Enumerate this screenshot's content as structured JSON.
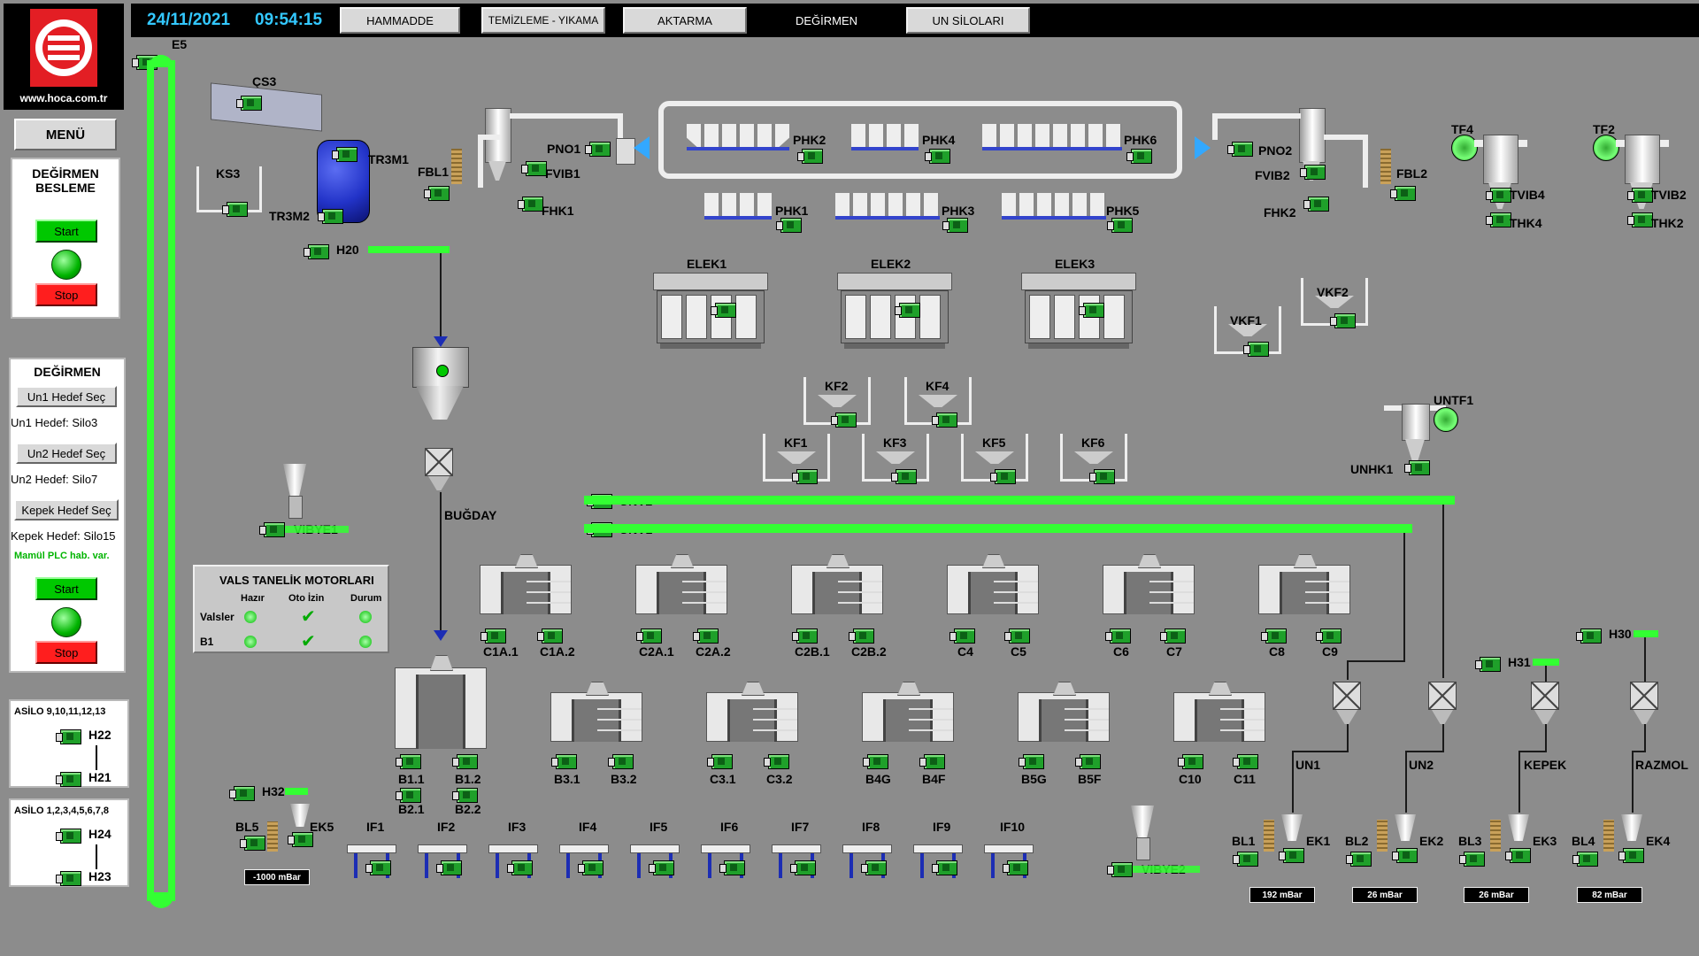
{
  "header": {
    "date": "24/11/2021",
    "time": "09:54:15",
    "logo_url": "www.hoca.com.tr",
    "tabs": [
      {
        "label": "HAMMADDE"
      },
      {
        "label": "TEMİZLEME - YIKAMA"
      },
      {
        "label": "AKTARMA"
      },
      {
        "label": "DEĞİRMEN"
      },
      {
        "label": "UN SİLOLARI"
      }
    ]
  },
  "menu_label": "MENÜ",
  "feed_panel": {
    "title_line1": "DEĞİRMEN",
    "title_line2": "BESLEME",
    "start": "Start",
    "stop": "Stop"
  },
  "mill_panel": {
    "title": "DEĞİRMEN",
    "un1_btn": "Un1 Hedef Seç",
    "un1_target": "Un1 Hedef: Silo3",
    "un2_btn": "Un2 Hedef Seç",
    "un2_target": "Un2 Hedef: Silo7",
    "kepek_btn": "Kepek Hedef Seç",
    "kepek_target": "Kepek Hedef: Silo15",
    "plc_note": "Mamül PLC hab. var.",
    "start": "Start",
    "stop": "Stop"
  },
  "asilo_a": {
    "title": "ASİLO 9,10,11,12,13",
    "m1": "H22",
    "m2": "H21"
  },
  "asilo_b": {
    "title": "ASİLO 1,2,3,4,5,6,7,8",
    "m1": "H24",
    "m2": "H23"
  },
  "vals_panel": {
    "title": "VALS TANELİK MOTORLARI",
    "col_ready": "Hazır",
    "col_auto": "Oto İzin",
    "col_state": "Durum",
    "rows": [
      {
        "name": "Valsler"
      },
      {
        "name": "B1"
      }
    ]
  },
  "labels": {
    "e5": "E5",
    "cs3": "ÇS3",
    "ks3": "KS3",
    "tr3m1": "TR3M1",
    "tr3m2": "TR3M2",
    "h20": "H20",
    "fbl1": "FBL1",
    "fvib1": "FVIB1",
    "fhk1": "FHK1",
    "pno1": "PNO1",
    "fbl2": "FBL2",
    "fvib2": "FVIB2",
    "fhk2": "FHK2",
    "pno2": "PNO2",
    "phk1": "PHK1",
    "phk2": "PHK2",
    "phk3": "PHK3",
    "phk4": "PHK4",
    "phk5": "PHK5",
    "phk6": "PHK6",
    "tf4": "TF4",
    "tvib4": "TVIB4",
    "thk4": "THK4",
    "tf2": "TF2",
    "tvib2": "TVIB2",
    "thk2": "THK2",
    "elek1": "ELEK1",
    "elek2": "ELEK2",
    "elek3": "ELEK3",
    "vkf1": "VKF1",
    "vkf2": "VKF2",
    "kf1": "KF1",
    "kf2": "KF2",
    "kf3": "KF3",
    "kf4": "KF4",
    "kf5": "KF5",
    "kf6": "KF6",
    "untf1": "UNTF1",
    "unhk1": "UNHK1",
    "bugday": "BUĞDAY",
    "vibye1": "VIBYE1",
    "vibye2": "VIBYE2",
    "unv1": "UNV1",
    "unv2": "UNV2",
    "h30": "H30",
    "h31": "H31",
    "h32": "H32",
    "un1": "UN1",
    "un2": "UN2",
    "kepek": "KEPEK",
    "razmol": "RAZMOL",
    "bl1": "BL1",
    "bl2": "BL2",
    "bl3": "BL3",
    "bl4": "BL4",
    "bl5": "BL5",
    "ek1": "EK1",
    "ek2": "EK2",
    "ek3": "EK3",
    "ek4": "EK4",
    "ek5": "EK5",
    "if1": "IF1",
    "if2": "IF2",
    "if3": "IF3",
    "if4": "IF4",
    "if5": "IF5",
    "if6": "IF6",
    "if7": "IF7",
    "if8": "IF8",
    "if9": "IF9",
    "if10": "IF10"
  },
  "roll_labels": [
    "C1A.1",
    "C1A.2",
    "C2A.1",
    "C2A.2",
    "C2B.1",
    "C2B.2",
    "C4",
    "C5",
    "C6",
    "C7",
    "C8",
    "C9",
    "B1.1",
    "B1.2",
    "B2.1",
    "B2.2",
    "B3.1",
    "B3.2",
    "C3.1",
    "C3.2",
    "B4G",
    "B4F",
    "B5G",
    "B5F",
    "C10",
    "C11"
  ],
  "pressures": {
    "bl5": "-1000 mBar",
    "bl1": "192 mBar",
    "bl2": "26 mBar",
    "bl3": "26 mBar",
    "bl4": "82 mBar"
  },
  "colors": {
    "accent_green": "#33ff33",
    "header_text": "#33c8ff",
    "motor_green": "#1fa02a",
    "stop_red": "#ff1e1e",
    "panel_bg": "#8c8c8c"
  }
}
